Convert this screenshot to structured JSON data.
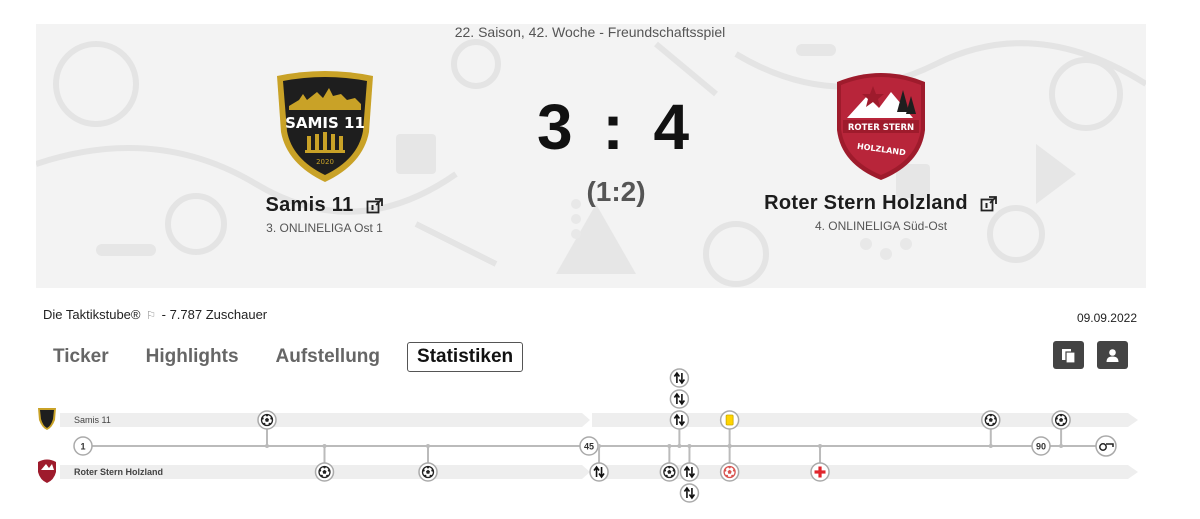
{
  "header": {
    "season_line": "22. Saison, 42. Woche - Freundschaftsspiel"
  },
  "home": {
    "name": "Samis 11",
    "league": "3. ONLINELIGA Ost 1",
    "crest_text": "SAMIS 11",
    "crest_year": "2020",
    "colors": {
      "primary": "#1e1e1e",
      "accent": "#c9a227"
    }
  },
  "away": {
    "name": "Roter Stern Holzland",
    "league": "4. ONLINELIGA Süd-Ost",
    "crest_text_top": "ROTER STERN",
    "crest_text_bottom": "HOLZLAND",
    "colors": {
      "primary": "#9e1b2c",
      "accent": "#ffffff"
    }
  },
  "score": {
    "final": "3 : 4",
    "halftime": "(1:2)"
  },
  "match_info": {
    "venue": "Die Taktikstube®",
    "venue_icon": "flag-icon",
    "spectators": " - 7.787 Zuschauer",
    "date": "09.09.2022"
  },
  "tabs": [
    {
      "label": "Ticker",
      "active": false
    },
    {
      "label": "Highlights",
      "active": false
    },
    {
      "label": "Aufstellung",
      "active": false
    },
    {
      "label": "Statistiken",
      "active": true
    }
  ],
  "toolbar": {
    "copy_icon": "copy-icon",
    "user_icon": "user-icon"
  },
  "timeline": {
    "home_label": "Samis 11",
    "away_label": "Roter Stern Holzland",
    "minute_markers": [
      "1",
      "45",
      "90"
    ],
    "end_icon": "whistle-icon",
    "home_events": [
      {
        "minute": 17,
        "type": "goal",
        "icon": "ball-icon"
      },
      {
        "minute": 54,
        "type": "substitution",
        "icon": "substitution-icon",
        "stack": 0
      },
      {
        "minute": 54,
        "type": "substitution",
        "icon": "substitution-icon",
        "stack": 1
      },
      {
        "minute": 54,
        "type": "substitution",
        "icon": "substitution-icon",
        "stack": 2
      },
      {
        "minute": 59,
        "type": "yellow-card",
        "icon": "yellow-card-icon"
      },
      {
        "minute": 85,
        "type": "goal",
        "icon": "ball-icon"
      },
      {
        "minute": 92,
        "type": "goal",
        "icon": "ball-icon"
      }
    ],
    "away_events": [
      {
        "minute": 22,
        "type": "goal",
        "icon": "ball-icon"
      },
      {
        "minute": 31,
        "type": "goal",
        "icon": "ball-icon"
      },
      {
        "minute": 46,
        "type": "substitution",
        "icon": "substitution-icon",
        "stack": 0
      },
      {
        "minute": 53,
        "type": "goal",
        "icon": "ball-icon"
      },
      {
        "minute": 55,
        "type": "substitution",
        "icon": "substitution-icon",
        "stack": 0
      },
      {
        "minute": 55,
        "type": "substitution",
        "icon": "substitution-icon",
        "stack": 1
      },
      {
        "minute": 59,
        "type": "own-goal",
        "icon": "own-goal-icon"
      },
      {
        "minute": 68,
        "type": "injury",
        "icon": "injury-icon"
      }
    ]
  }
}
